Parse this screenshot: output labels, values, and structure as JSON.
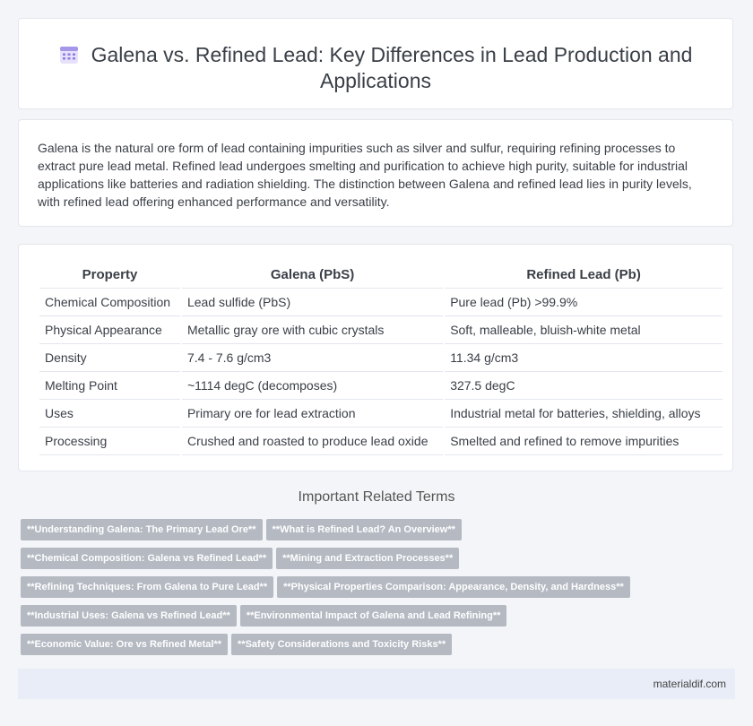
{
  "header": {
    "title": "Galena vs. Refined Lead: Key Differences in Lead Production and Applications",
    "icon": "calendar-grid-icon"
  },
  "intro": "Galena is the natural ore form of lead containing impurities such as silver and sulfur, requiring refining processes to extract pure lead metal. Refined lead undergoes smelting and purification to achieve high purity, suitable for industrial applications like batteries and radiation shielding. The distinction between Galena and refined lead lies in purity levels, with refined lead offering enhanced performance and versatility.",
  "table": {
    "headers": [
      "Property",
      "Galena (PbS)",
      "Refined Lead (Pb)"
    ],
    "rows": [
      [
        "Chemical Composition",
        "Lead sulfide (PbS)",
        "Pure lead (Pb) >99.9%"
      ],
      [
        "Physical Appearance",
        "Metallic gray ore with cubic crystals",
        "Soft, malleable, bluish-white metal"
      ],
      [
        "Density",
        "7.4 - 7.6 g/cm3",
        "11.34 g/cm3"
      ],
      [
        "Melting Point",
        "~1114 degC (decomposes)",
        "327.5 degC"
      ],
      [
        "Uses",
        "Primary ore for lead extraction",
        "Industrial metal for batteries, shielding, alloys"
      ],
      [
        "Processing",
        "Crushed and roasted to produce lead oxide",
        "Smelted and refined to remove impurities"
      ]
    ]
  },
  "terms": {
    "title": "Important Related Terms",
    "rows": [
      [
        "**Understanding Galena: The Primary Lead Ore**",
        "**What is Refined Lead? An Overview**"
      ],
      [
        "**Chemical Composition: Galena vs Refined Lead**",
        "**Mining and Extraction Processes**"
      ],
      [
        "**Refining Techniques: From Galena to Pure Lead**",
        "**Physical Properties Comparison: Appearance, Density, and Hardness**"
      ],
      [
        "**Industrial Uses: Galena vs Refined Lead**",
        "**Environmental Impact of Galena and Lead Refining**"
      ],
      [
        "**Economic Value: Ore vs Refined Metal**",
        "**Safety Considerations and Toxicity Risks**"
      ]
    ]
  },
  "footer": {
    "site": "materialdif.com"
  },
  "colors": {
    "tag_bg": "#b4b9c2",
    "icon_accent": "#8f7be0",
    "footer_bg": "#e8edf7"
  }
}
